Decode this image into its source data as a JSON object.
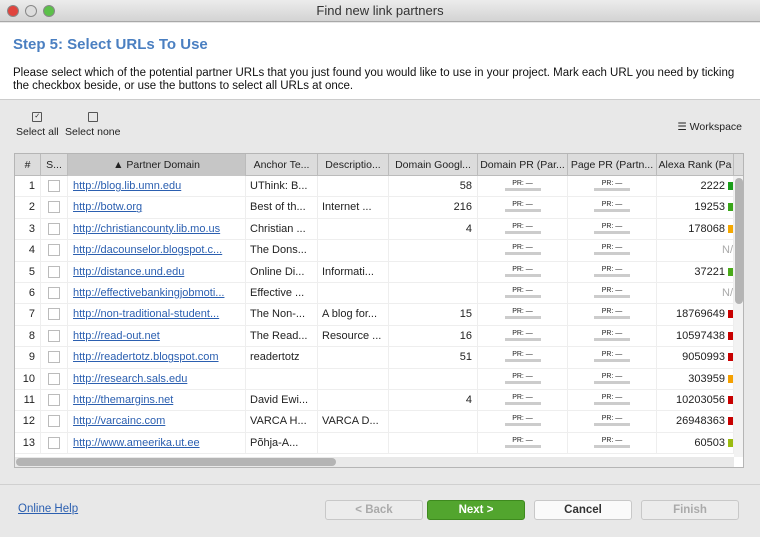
{
  "window": {
    "title": "Find new link partners"
  },
  "header": {
    "step_title": "Step 5: Select URLs To Use",
    "description": "Please select which of the potential partner URLs that you just found you would like to use in your project. Mark each URL you need by ticking the checkbox beside, or use the buttons to select all URLs at once."
  },
  "toolbar": {
    "select_all": "Select all",
    "select_none": "Select none",
    "workspace": "Workspace"
  },
  "table": {
    "columns": [
      "#",
      "S...",
      "▲ Partner Domain",
      "Anchor Te...",
      "Descriptio...",
      "Domain Googl...",
      "Domain PR (Par...",
      "Page PR (Partn...",
      "Alexa Rank (Pa"
    ],
    "pr_label": "PR: —",
    "rows": [
      {
        "n": "1",
        "domain": "http://blog.lib.umn.edu",
        "anchor": "UThink: B...",
        "desc": "",
        "google": "58",
        "alexa": "2222",
        "rank_color": "#1a9e1a"
      },
      {
        "n": "2",
        "domain": "http://botw.org",
        "anchor": "Best of th...",
        "desc": "Internet ...",
        "google": "216",
        "alexa": "19253",
        "rank_color": "#3aa61a"
      },
      {
        "n": "3",
        "domain": "http://christiancounty.lib.mo.us",
        "anchor": "Christian ...",
        "desc": "",
        "google": "4",
        "alexa": "178068",
        "rank_color": "#f5a800"
      },
      {
        "n": "4",
        "domain": "http://dacounselor.blogspot.c...",
        "anchor": "The Dons...",
        "desc": "",
        "google": "",
        "alexa": "N/",
        "rank_color": ""
      },
      {
        "n": "5",
        "domain": "http://distance.und.edu",
        "anchor": "Online Di...",
        "desc": "Informati...",
        "google": "",
        "alexa": "37221",
        "rank_color": "#4aaa1a"
      },
      {
        "n": "6",
        "domain": "http://effectivebankingjobmoti...",
        "anchor": "Effective ...",
        "desc": "",
        "google": "",
        "alexa": "N/",
        "rank_color": ""
      },
      {
        "n": "7",
        "domain": "http://non-traditional-student...",
        "anchor": "The Non-...",
        "desc": "A blog for...",
        "google": "15",
        "alexa": "18769649",
        "rank_color": "#c80000"
      },
      {
        "n": "8",
        "domain": "http://read-out.net",
        "anchor": "The Read...",
        "desc": "Resource ...",
        "google": "16",
        "alexa": "10597438",
        "rank_color": "#c80000"
      },
      {
        "n": "9",
        "domain": "http://readertotz.blogspot.com",
        "anchor": "readertotz",
        "desc": "",
        "google": "51",
        "alexa": "9050993",
        "rank_color": "#c80000"
      },
      {
        "n": "10",
        "domain": "http://research.sals.edu",
        "anchor": "",
        "desc": "",
        "google": "",
        "alexa": "303959",
        "rank_color": "#f5a000"
      },
      {
        "n": "11",
        "domain": "http://themargins.net",
        "anchor": "David Ewi...",
        "desc": "",
        "google": "4",
        "alexa": "10203056",
        "rank_color": "#c80000"
      },
      {
        "n": "12",
        "domain": "http://varcainc.com",
        "anchor": "VARCA H...",
        "desc": "VARCA D...",
        "google": "",
        "alexa": "26948363",
        "rank_color": "#c80000"
      },
      {
        "n": "13",
        "domain": "http://www.ameerika.ut.ee",
        "anchor": "Põhja-A...",
        "desc": "",
        "google": "",
        "alexa": "60503",
        "rank_color": "#9bbb10"
      }
    ]
  },
  "footer": {
    "help": "Online Help",
    "back": "< Back",
    "next": "Next >",
    "cancel": "Cancel",
    "finish": "Finish"
  }
}
